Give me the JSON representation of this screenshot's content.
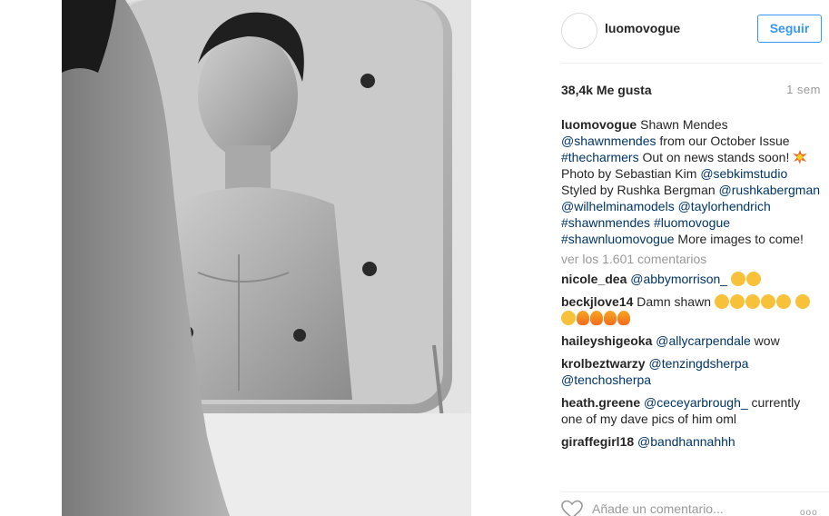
{
  "header": {
    "username": "luomovogue",
    "follow_label": "Seguir"
  },
  "stats": {
    "likes": "38,4k Me gusta",
    "time": "1 sem"
  },
  "caption": {
    "user": "luomovogue",
    "t1": "Shawn Mendes",
    "mention_shawn": "@shawnmendes",
    "t2": "from our October Issue",
    "tag_charmers": "#thecharmers",
    "t3": "Out on news stands soon!",
    "t4": "Photo by Sebastian Kim",
    "mention_sebkim": "@sebkimstudio",
    "t5": "Styled by Rushka Bergman",
    "mention_rushka": "@rushkabergman",
    "mention_wilhelmina": "@wilhelminamodels",
    "mention_taylor": "@taylorhendrich",
    "tag_shawnmendes": "#shawnmendes",
    "tag_luomovogue": "#luomovogue",
    "tag_shawnluomovogue": "#shawnluomovogue",
    "t6": "More images to come!"
  },
  "view_all": "ver los 1.601 comentarios",
  "comments": [
    {
      "user": "nicole_dea",
      "mention": "@abbymorrison_",
      "text": ""
    },
    {
      "user": "beckjlove14",
      "mention": "",
      "text": "Damn shawn"
    },
    {
      "user": "haileyshigeoka",
      "mention": "@allycarpendale",
      "text": "wow"
    },
    {
      "user": "krolbeztwarzy",
      "mention": "@tenzingdsherpa",
      "mention2": "@tenchosherpa",
      "text": ""
    },
    {
      "user": "heath.greene",
      "mention": "@ceceyarbrough_",
      "text": "currently one of my dave pics of him oml"
    },
    {
      "user": "giraffegirl18",
      "mention": "@bandhannahhh",
      "text": ""
    }
  ],
  "add_comment": {
    "placeholder": "Añade un comentario..."
  },
  "more": "ooo",
  "icons": {
    "like": "heart-outline-icon",
    "more": "more-options-icon",
    "burst": "collision-emoji-icon"
  }
}
